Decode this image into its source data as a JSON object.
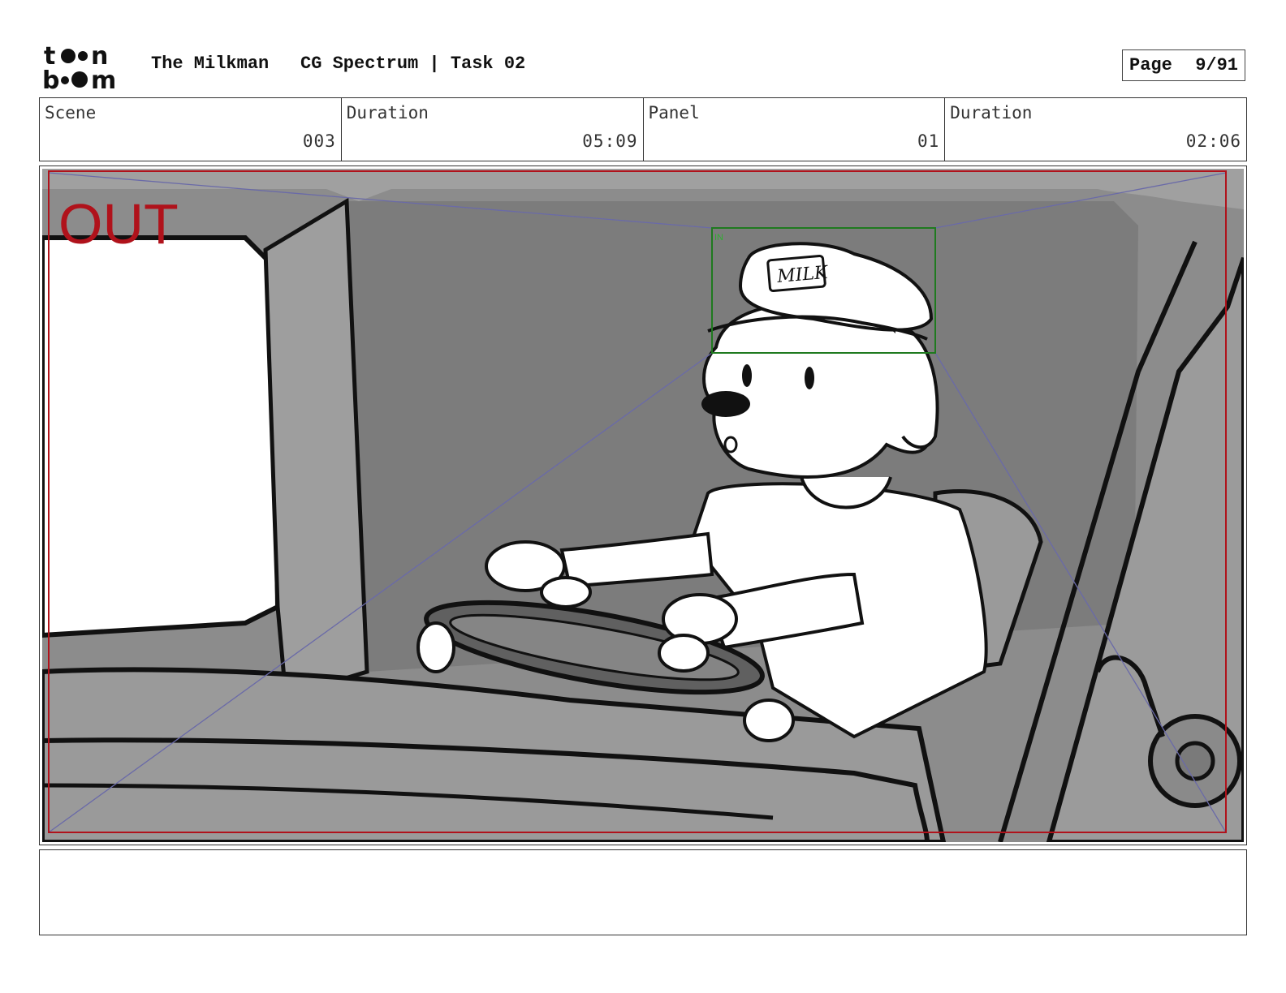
{
  "header": {
    "logo_alt": "toon boom",
    "project": "The Milkman",
    "task": "CG Spectrum | Task 02",
    "page_label": "Page",
    "page_value": "9/91"
  },
  "info": [
    {
      "label": "Scene",
      "value": "003"
    },
    {
      "label": "Duration",
      "value": "05:09"
    },
    {
      "label": "Panel",
      "value": "01"
    },
    {
      "label": "Duration",
      "value": "02:06"
    }
  ],
  "panel": {
    "out_label": "OUT",
    "in_label": "IN",
    "hat_text": "MILK",
    "out_frame_color": "#b0121b",
    "in_frame_color": "#1f7a1f",
    "camera_lines_color": "#6a6aa8"
  },
  "notes": {
    "text": ""
  }
}
